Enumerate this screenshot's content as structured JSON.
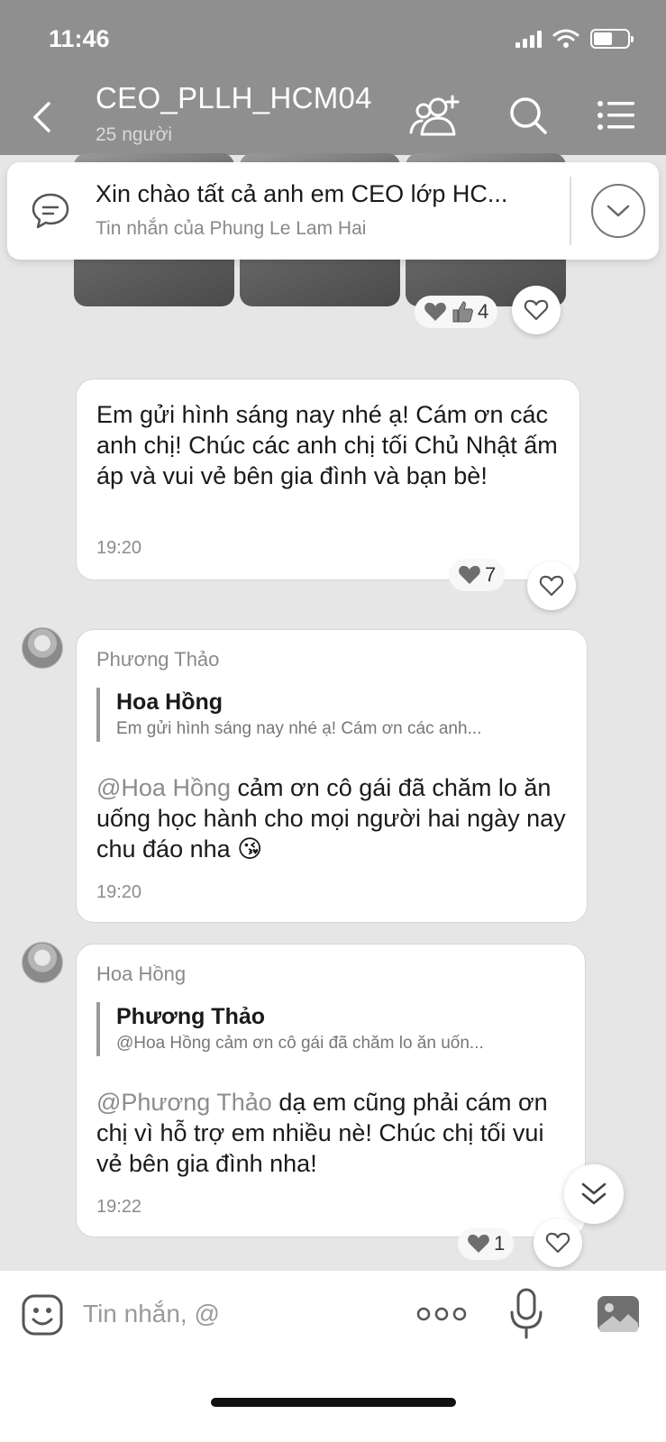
{
  "status_bar": {
    "time": "11:46"
  },
  "header": {
    "title": "CEO_PLLH_HCM04",
    "subtitle": "25 người",
    "icons": [
      "back-icon",
      "add-member-icon",
      "search-icon",
      "menu-icon"
    ]
  },
  "pinned": {
    "title": "Xin chào tất cả anh em CEO lớp HC...",
    "subtitle": "Tin nhắn của Phung Le Lam Hai"
  },
  "top_reaction": {
    "count": "4",
    "icons": [
      "heart-icon",
      "thumbs-up-icon"
    ]
  },
  "messages": [
    {
      "text": "Em gửi hình sáng nay nhé ạ! Cám ơn các anh chị! Chúc các anh chị tối Chủ Nhật ấm áp và vui vẻ bên gia đình và bạn bè!",
      "time": "19:20",
      "reaction_count": "7"
    },
    {
      "sender": "Phương Thảo",
      "quote_name": "Hoa Hồng",
      "quote_text": "Em gửi hình sáng nay nhé ạ! Cám ơn các anh...",
      "mention": "@Hoa Hồng",
      "text": " cảm ơn cô gái đã chăm lo ăn uống học hành cho mọi người hai ngày nay chu đáo nha 😘",
      "time": "19:20"
    },
    {
      "sender": "Hoa Hồng",
      "quote_name": "Phương Thảo",
      "quote_text": "@Hoa Hồng cảm ơn cô gái đã chăm lo ăn uốn...",
      "mention": "@Phương Thảo",
      "text": " dạ em cũng phải cám ơn chị vì hỗ trợ em nhiều nè! Chúc chị tối vui vẻ bên gia đình nha!",
      "time": "19:22",
      "reaction_count": "1"
    }
  ],
  "input": {
    "placeholder": "Tin nhắn, @"
  },
  "colors": {
    "header_bg": "#8f8f8f",
    "chat_bg": "#e6e6e6",
    "bubble_bg": "#ffffff",
    "mention": "#8c8c8c"
  }
}
